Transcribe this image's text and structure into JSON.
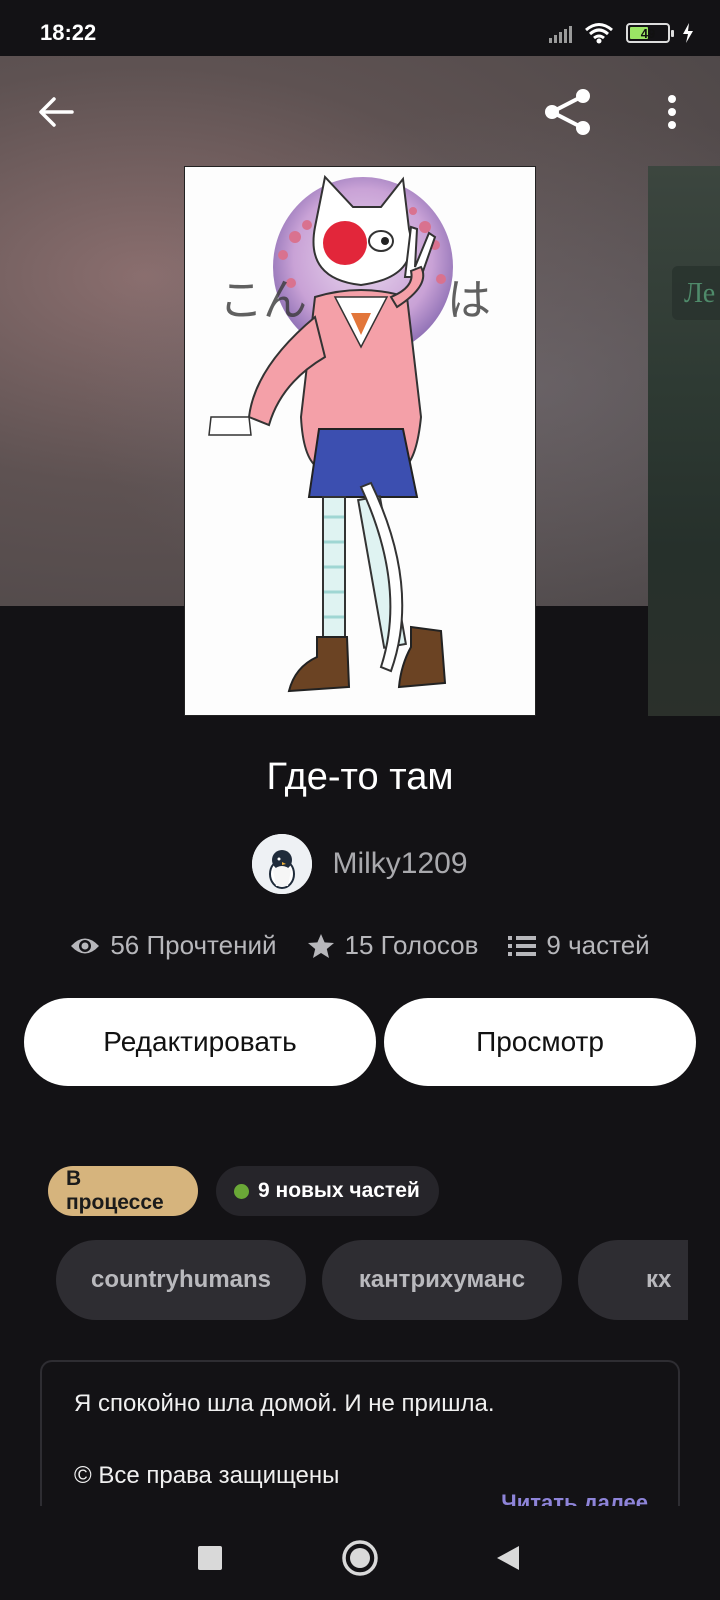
{
  "status_bar": {
    "time": "18:22",
    "battery": "49"
  },
  "hero": {
    "second_cover_text": "Ле"
  },
  "story": {
    "title": "Где-то там",
    "author": "Milky1209",
    "reads": "56 Прочтений",
    "votes": "15 Голосов",
    "parts": "9 частей"
  },
  "actions": {
    "edit_label": "Редактировать",
    "view_label": "Просмотр"
  },
  "badges": {
    "status": "В процессе",
    "new_parts": "9 новых частей"
  },
  "tags": [
    "countryhumans",
    "кантрихуманс",
    "кх"
  ],
  "description": {
    "line1": "Я спокойно шла домой. И не пришла.",
    "line2": "© Все права защищены",
    "read_more": "Читать далее"
  },
  "colors": {
    "background": "#131215",
    "status_badge": "#d6b47d",
    "new_dot": "#6aa837",
    "read_more": "#8e84d9"
  },
  "icons": [
    "back-arrow-icon",
    "share-icon",
    "more-vertical-icon",
    "eye-icon",
    "star-icon",
    "list-icon",
    "nav-square-icon",
    "nav-circle-icon",
    "nav-triangle-icon"
  ]
}
